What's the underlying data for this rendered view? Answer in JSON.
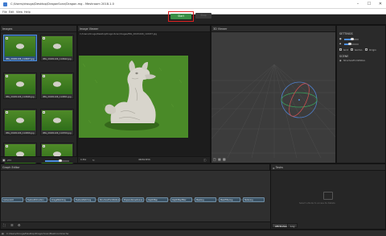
{
  "window": {
    "title": "C:/Users/drouga/Desktop/DragonScan/Dragon.mg - Meshroom 2018.1.0",
    "minimize_glyph": "–",
    "maximize_glyph": "☐",
    "close_glyph": "✕"
  },
  "menu": [
    "File",
    "Edit",
    "View",
    "Help"
  ],
  "toolbar": {
    "start_label": "Start",
    "stop_label": "Stop"
  },
  "images": {
    "title": "Images",
    "items": [
      {
        "label": "IMG_20181106_110637.jpg",
        "selected": true
      },
      {
        "label": "IMG_20181106_110642.jpg",
        "selected": false
      },
      {
        "label": "IMG_20181106_110646.jpg",
        "selected": false
      },
      {
        "label": "IMG_20181106_110651.jpg",
        "selected": false
      },
      {
        "label": "IMG_20181106_110656.jpg",
        "selected": false
      },
      {
        "label": "IMG_20181106_110700.jpg",
        "selected": false
      },
      {
        "label": "IMG_20181106_110705.jpg",
        "selected": false
      },
      {
        "label": "IMG_20181106_110710.jpg",
        "selected": false
      },
      {
        "label": "IMG_20181106_110715.jpg",
        "selected": false
      },
      {
        "label": "IMG_20181106_110720.jpg",
        "selected": false
      }
    ],
    "count": "273"
  },
  "viewer": {
    "title": "Image Viewer",
    "path": "C:/Users/drouga/Desktop/DragonScan/Images/IMG_20181106_110637.jpg",
    "zoom": "0.36x",
    "resolution": "4608x3456"
  },
  "viewer3d": {
    "title": "3D Viewer"
  },
  "settings": {
    "title": "SETTINGS",
    "slider1": 0.55,
    "slider2": 0.35,
    "grid_label": "Grid",
    "gizmo_label": "Gizmo",
    "origin_label": "Origin",
    "scene_title": "SCENE",
    "scene_item": "StructureFromMotion"
  },
  "graph": {
    "title": "Graph Editor",
    "nodes": [
      "CameraInit",
      "FeatureExtraction",
      "ImageMatching",
      "FeatureMatching",
      "StructureFromMotion",
      "PrepareDenseScene",
      "DepthMap",
      "DepthMapFilter",
      "Meshing",
      "MeshFiltering",
      "Texturing"
    ]
  },
  "tasks": {
    "title": "Tasks",
    "placeholder": "Select a Node to access its Details",
    "tabs": [
      {
        "label": "Attributes",
        "active": true
      },
      {
        "label": "Log",
        "active": false
      }
    ]
  },
  "status": {
    "text": "C:/Users/drouga/Desktop/DragonScan/MeshroomCache"
  },
  "colors": {
    "accent": "#4d8fe0",
    "start": "#3a8f46",
    "highlight": "#e02020"
  }
}
